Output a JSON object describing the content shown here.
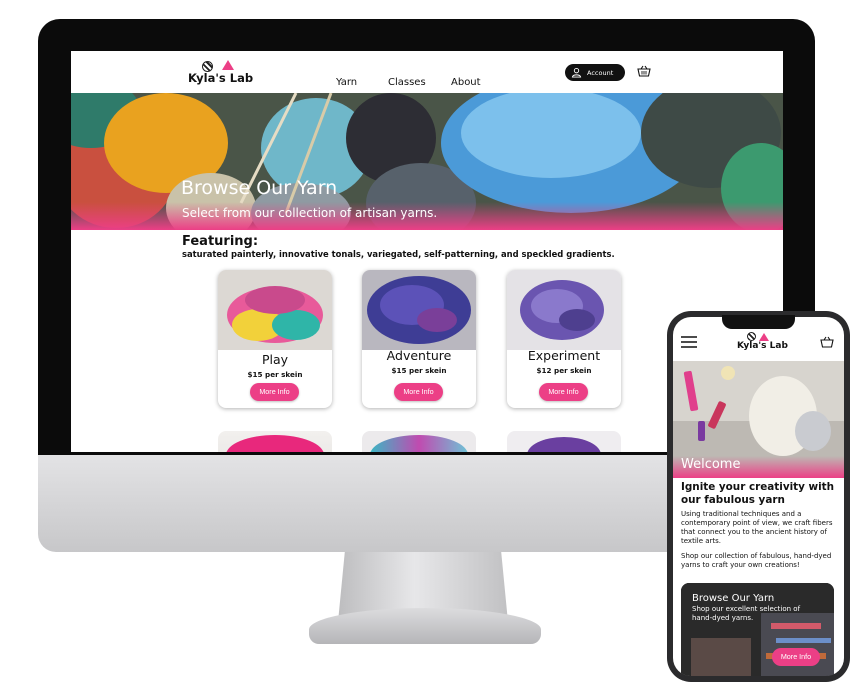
{
  "brand": {
    "name": "Kyla's Lab",
    "accent": "#ec3f86"
  },
  "desktop": {
    "nav": [
      {
        "label": "Yarn"
      },
      {
        "label": "Classes"
      },
      {
        "label": "About"
      }
    ],
    "account_label": "Account",
    "hero": {
      "title": "Browse Our Yarn",
      "subtitle": "Select from our collection of artisan yarns."
    },
    "featuring": {
      "heading": "Featuring:",
      "text": "saturated painterly, innovative tonals, variegated, self-patterning, and speckled gradients."
    },
    "products": [
      {
        "name": "Play",
        "price": "$15 per skein",
        "button": "More Info"
      },
      {
        "name": "Adventure",
        "price": "$15 per skein",
        "button": "More Info"
      },
      {
        "name": "Experiment",
        "price": "$12 per skein",
        "button": "More Info"
      }
    ]
  },
  "mobile": {
    "hero_label": "Welcome",
    "heading": "Ignite your creativity with our fabulous yarn",
    "paragraph1": "Using traditional techniques and a contemporary point of view, we craft fibers that connect you to the ancient history of textile arts.",
    "paragraph2": "Shop our collection of fabulous, hand-dyed yarns to craft your own creations!",
    "card": {
      "title": "Browse Our Yarn",
      "subtitle": "Shop our excellent selection of hand-dyed yarns.",
      "button": "More Info"
    }
  },
  "icons": [
    "menu-icon",
    "cart-icon",
    "account-icon",
    "logo-yarn-icon"
  ]
}
